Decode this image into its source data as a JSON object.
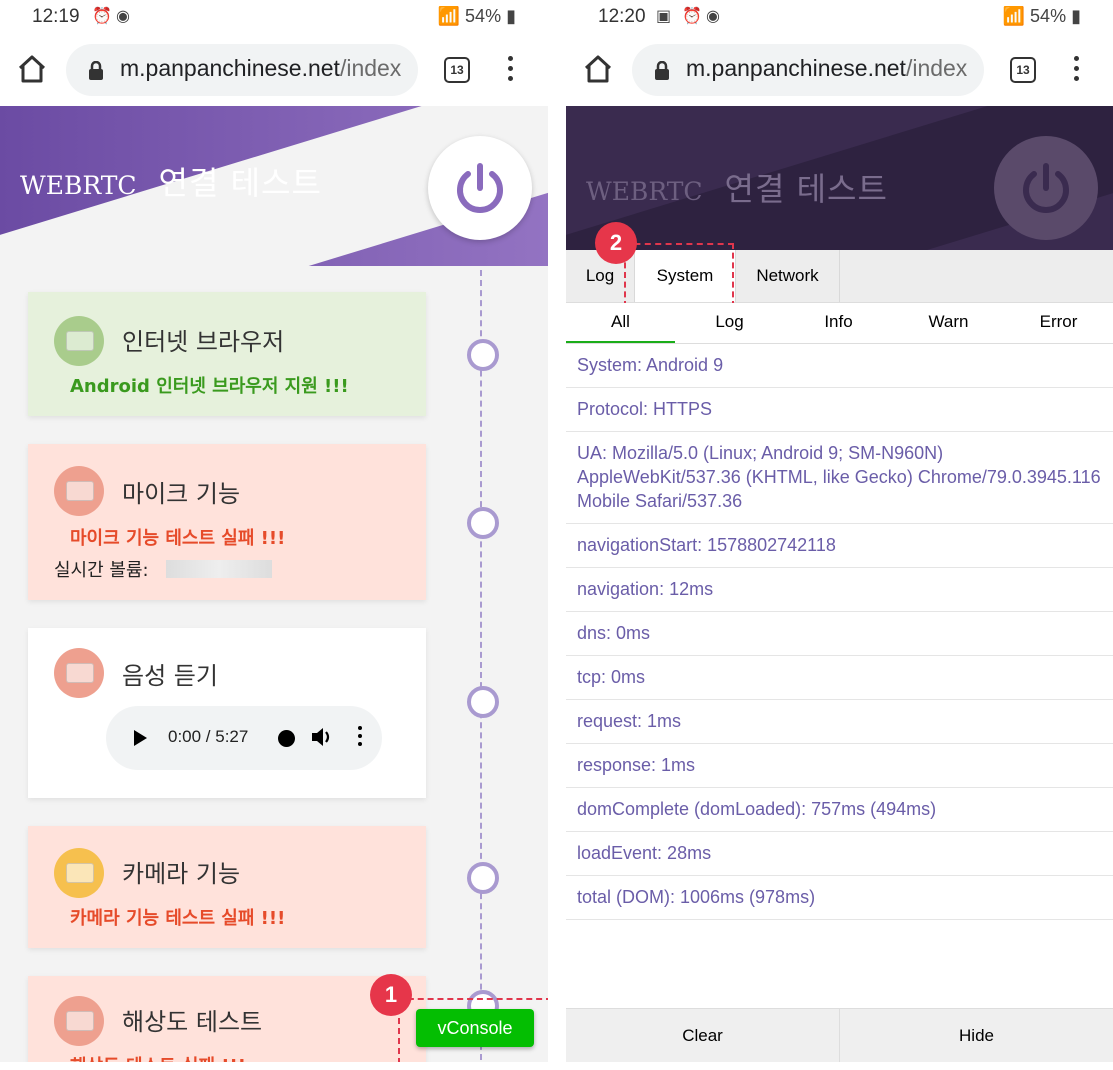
{
  "left": {
    "status": {
      "time": "12:19",
      "battery": "54%"
    },
    "browser": {
      "url_host": "m.panpanchinese.net",
      "url_path": "/index",
      "tab_count": "13"
    },
    "header": {
      "brand": "WEBRTC",
      "title": "연결 테스트"
    },
    "cards": [
      {
        "title": "인터넷 브라우저",
        "status": "Android 인터넷 브라우저 지원 !!!"
      },
      {
        "title": "마이크 기능",
        "status": "마이크 기능 테스트 실패 !!!",
        "volume_label": "실시간 볼륨:"
      },
      {
        "title": "음성 듣기",
        "audio_time": "0:00 / 5:27"
      },
      {
        "title": "카메라 기능",
        "status": "카메라 기능 테스트 실패 !!!"
      },
      {
        "title": "해상도 테스트",
        "status": "해상도 테스트 실패 !!!"
      }
    ],
    "vconsole_label": "vConsole",
    "badge": "1"
  },
  "right": {
    "status": {
      "time": "12:20",
      "battery": "54%"
    },
    "browser": {
      "url_host": "m.panpanchinese.net",
      "url_path": "/index",
      "tab_count": "13"
    },
    "header": {
      "brand": "WEBRTC",
      "title": "연결 테스트"
    },
    "badge": "2",
    "tabs": [
      "Log",
      "System",
      "Network"
    ],
    "subtabs": [
      "All",
      "Log",
      "Info",
      "Warn",
      "Error"
    ],
    "rows": [
      "System: Android 9",
      "Protocol: HTTPS",
      "UA: Mozilla/5.0 (Linux; Android 9; SM-N960N) AppleWebKit/537.36 (KHTML, like Gecko) Chrome/79.0.3945.116 Mobile Safari/537.36",
      "navigationStart: 1578802742118",
      "navigation: 12ms",
      "dns: 0ms",
      "tcp: 0ms",
      "request: 1ms",
      "response: 1ms",
      "domComplete (domLoaded): 757ms (494ms)",
      "loadEvent: 28ms",
      "total (DOM): 1006ms (978ms)"
    ],
    "footer": {
      "clear": "Clear",
      "hide": "Hide"
    }
  }
}
